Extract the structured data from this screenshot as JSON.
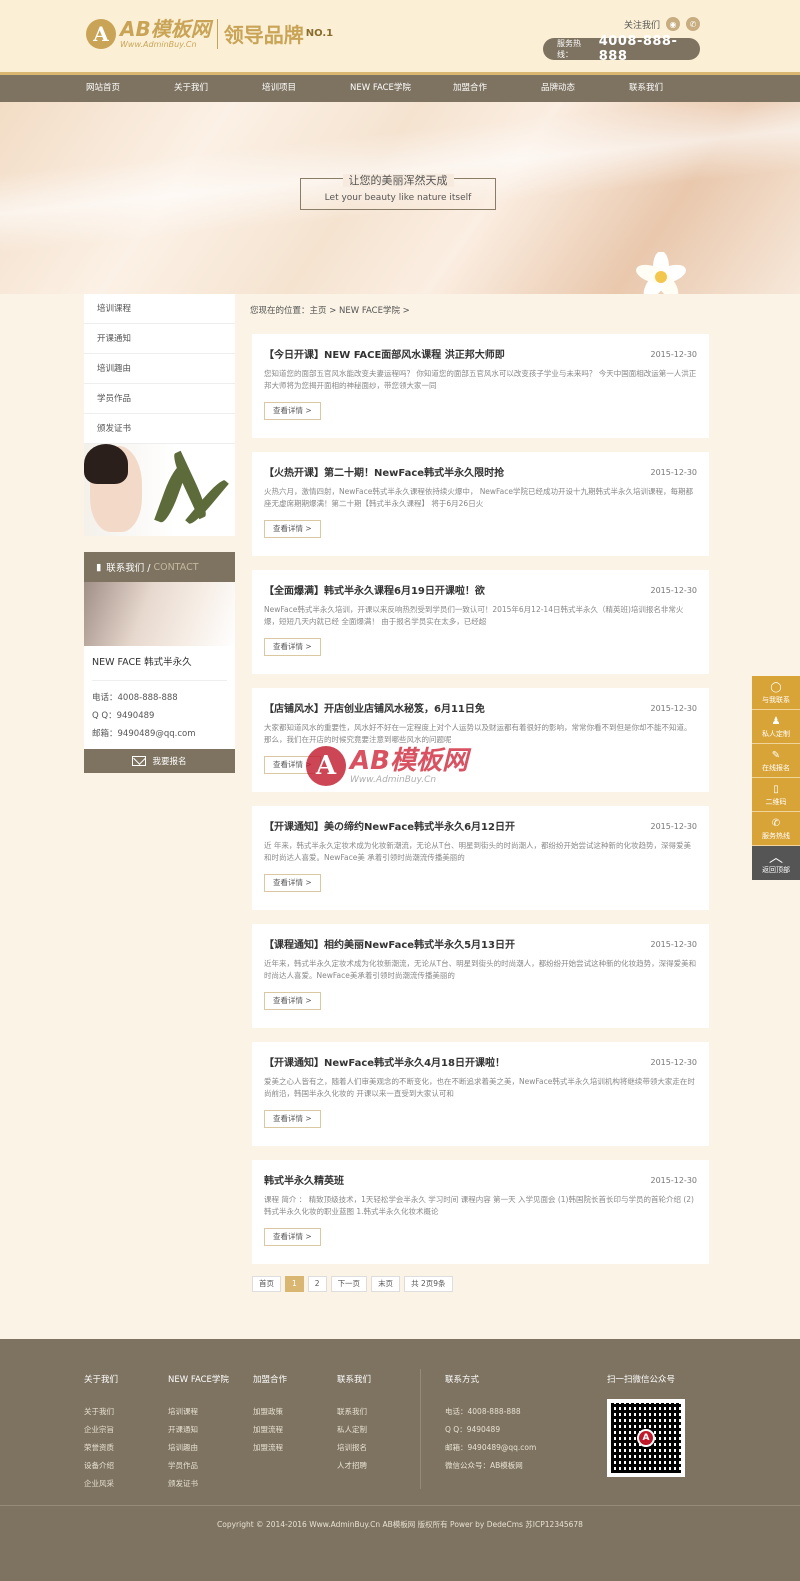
{
  "header": {
    "logo_cn": "AB模板网",
    "logo_en": "Www.AdminBuy.Cn",
    "slogan": "领导品牌",
    "slogan_no": "NO.1",
    "follow_label": "关注我们",
    "hotline_label": "服务热线：",
    "hotline_number": "4008-888-888"
  },
  "nav": [
    "网站首页",
    "关于我们",
    "培训项目",
    "NEW FACE学院",
    "加盟合作",
    "品牌动态",
    "联系我们"
  ],
  "banner": {
    "cn": "让您的美丽浑然天成",
    "en": "Let your beauty like nature itself"
  },
  "sidebar": {
    "menu": [
      "培训课程",
      "开课通知",
      "培训趣由",
      "学员作品",
      "颁发证书"
    ],
    "contact_head_cn": "联系我们 /",
    "contact_head_en": "CONTACT",
    "contact_title": "NEW FACE 韩式半永久",
    "phone": "电话：4008-888-888",
    "qq": "Q Q：9490489",
    "email": "邮箱：9490489@qq.com",
    "signup": "我要报名"
  },
  "breadcrumb": "您现在的位置：主页 > NEW FACE学院 >",
  "more_label": "查看详情 >",
  "articles": [
    {
      "title": "【今日开课】NEW FACE面部风水课程 洪正邦大师即",
      "date": "2015-12-30",
      "desc": "您知道您的面部五官风水能改变夫妻运程吗？ 你知道您的面部五官风水可以改变孩子学业与未来吗？ 今天中国面相改运第一人洪正邦大师将为您揭开面相的神秘面纱，带您领大家一同"
    },
    {
      "title": "【火热开课】第二十期！NewFace韩式半永久限时抢",
      "date": "2015-12-30",
      "desc": "火热六月，激情四射，NewFace韩式半永久课程依持续火爆中， NewFace学院已经成功开设十九期韩式半永久培训课程，每期都座无虚席期期爆满！第二十期【韩式半永久课程】 将于6月26日火"
    },
    {
      "title": "【全面爆满】韩式半永久课程6月19日开课啦！欲",
      "date": "2015-12-30",
      "desc": "NewFace韩式半永久培训，开课以来反响热烈受到学员们一致认可！2015年6月12-14日韩式半永久（精英班)培训报名非常火爆，短短几天内就已经 全面爆满！ 由于报名学员实在太多，已经超"
    },
    {
      "title": "【店铺风水】开店创业店铺风水秘笈，6月11日免",
      "date": "2015-12-30",
      "desc": "大家都知道风水的重要性，风水好不好在一定程度上对个人运势以及财运都有着很好的影响，常常你看不到但是你却不能不知道。 那么，我们在开店的时候究竟要注意到哪些风水的问题呢"
    },
    {
      "title": "【开课通知】美の缔约NewFace韩式半永久6月12日开",
      "date": "2015-12-30",
      "desc": "近 年来，韩式半永久定妆术成为化妆新潮流，无论从T台、明星到街头的时尚潮人，都纷纷开始尝试这种新的化妆趋势，深得爱美和时尚达人喜爱。NewFace美 承着引领时尚潮流传播美丽的"
    },
    {
      "title": "【课程通知】相约美丽NewFace韩式半永久5月13日开",
      "date": "2015-12-30",
      "desc": "近年来，韩式半永久定妆术成为化妆新潮流，无论从T台、明星到街头的时尚潮人，都纷纷开始尝试这种新的化妆趋势，深得爱美和时尚达人喜爱。NewFace美承着引领时尚潮流传播美丽的"
    },
    {
      "title": "【开课通知】NewFace韩式半永久4月18日开课啦！",
      "date": "2015-12-30",
      "desc": "爱美之心人皆有之，随着人们审美观念的不断变化，也在不断追求着美之美，NewFace韩式半永久培训机构将继续带领大家走在时尚前沿，韩国半永久化妆的 开课以来一直受到大家认可和"
    },
    {
      "title": "韩式半永久精英班",
      "date": "2015-12-30",
      "desc": "课程 简介 ： 精致顶级技术，1天轻松学会半永久 学习时间 课程内容 第一天 入学见面会 (1)韩国院长首长印与学员的首轮介绍 (2)韩式半永久化妆的职业蓝图 1.韩式半永久化妆术概论"
    }
  ],
  "pager": [
    "首页",
    "1",
    "2",
    "下一页",
    "末页",
    "共 2页9条"
  ],
  "watermark": {
    "cn": "AB模板网",
    "en": "Www.AdminBuy.Cn"
  },
  "float": [
    "与我联系",
    "私人定制",
    "在线报名",
    "二维码",
    "服务热线",
    "返回顶部"
  ],
  "footer": {
    "cols": [
      {
        "head": "关于我们",
        "links": [
          "关于我们",
          "企业宗旨",
          "荣誉资质",
          "设备介绍",
          "企业风采"
        ]
      },
      {
        "head": "NEW FACE学院",
        "links": [
          "培训课程",
          "开课通知",
          "培训趣由",
          "学员作品",
          "颁发证书"
        ]
      },
      {
        "head": "加盟合作",
        "links": [
          "加盟政策",
          "加盟流程",
          "加盟流程"
        ]
      },
      {
        "head": "联系我们",
        "links": [
          "联系我们",
          "私人定制",
          "培训报名",
          "人才招聘"
        ]
      }
    ],
    "contact_head": "联系方式",
    "contact_lines": [
      "电话：4008-888-888",
      "Q Q：9490489",
      "邮箱：9490489@qq.com",
      "微信公众号：AB模板网"
    ],
    "qr_head": "扫一扫微信公众号",
    "copyright": "Copyright © 2014-2016 Www.AdminBuy.Cn AB模板网 版权所有 Power by DedeCms 苏ICP12345678"
  },
  "colors": {
    "brand_gold": "#c9a457",
    "nav_brown": "#7e7361",
    "float_orange": "#d9a437",
    "bg": "#faf3e6"
  }
}
